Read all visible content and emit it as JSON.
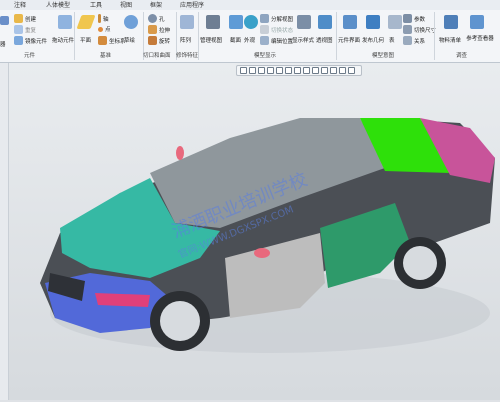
{
  "tabs": [
    "注释",
    "人体模型",
    "工具",
    "视图",
    "框架",
    "应用程序"
  ],
  "ribbon": {
    "ops": {
      "create": "创建",
      "drag_elements": "拖动元件",
      "mirror": "镜像元件",
      "truncated_left_label": "器",
      "group_label": "元件"
    },
    "datum": {
      "plane": "平面",
      "axis": "轴",
      "point": "点",
      "csys": "坐标系",
      "curve": "草绘",
      "group_label": "基准"
    },
    "cut": {
      "hole": "孔",
      "extrude": "拉伸",
      "revolve": "旋转",
      "group_label": "切口和曲面"
    },
    "mod": {
      "pattern": "阵列",
      "group_label": "修饰特征"
    },
    "display": {
      "manage_views": "管理视图",
      "section": "截面",
      "appearance": "外观",
      "exploded_view": "分解视图",
      "edit_position": "编辑位置",
      "display_style": "显示样式",
      "perspective": "透视图",
      "group_label": "模型显示"
    },
    "intent": {
      "component_interface": "元件界面",
      "publish_geom": "发布几何",
      "table": "表",
      "parameters": "参数",
      "switch_dims": "切换尺寸",
      "relations": "关系",
      "group_label": "模型意图"
    },
    "investigate": {
      "bom": "物料清单",
      "reference_viewer": "参考查看器",
      "group_label": "调查"
    }
  },
  "watermark": {
    "line1": "浦酒职业培训学校",
    "line2": "官网:WWW.DGXSPX.COM"
  },
  "colors": {
    "hood": "#36b9a4",
    "roof": "#8f979c",
    "rear_window": "#2ee00a",
    "trunk": "#c8549a",
    "front_bumper": "#5269d9",
    "fender_pink": "#e0407a",
    "front_door": "#bdbdbd",
    "rear_door": "#2e9a6a",
    "body": "#4b4f55",
    "mirror": "#e8697d"
  },
  "icons": [
    "create-icon",
    "drag-icon",
    "mirror-icon",
    "plane-icon",
    "axis-icon",
    "point-icon",
    "csys-icon",
    "curve-icon",
    "hole-icon",
    "extrude-icon",
    "revolve-icon",
    "pattern-icon",
    "manage-views-icon",
    "section-icon",
    "appearance-icon",
    "display-style-icon",
    "interface-icon",
    "publish-icon",
    "table-icon",
    "parameters-icon",
    "bom-icon",
    "reference-viewer-icon",
    "zoom-in-icon",
    "zoom-out-icon",
    "refit-icon",
    "repaint-icon",
    "orient-icon",
    "saved-views-icon",
    "display-style-mini-icon",
    "datum-display-icon",
    "spin-center-icon",
    "annotation-display-icon"
  ]
}
